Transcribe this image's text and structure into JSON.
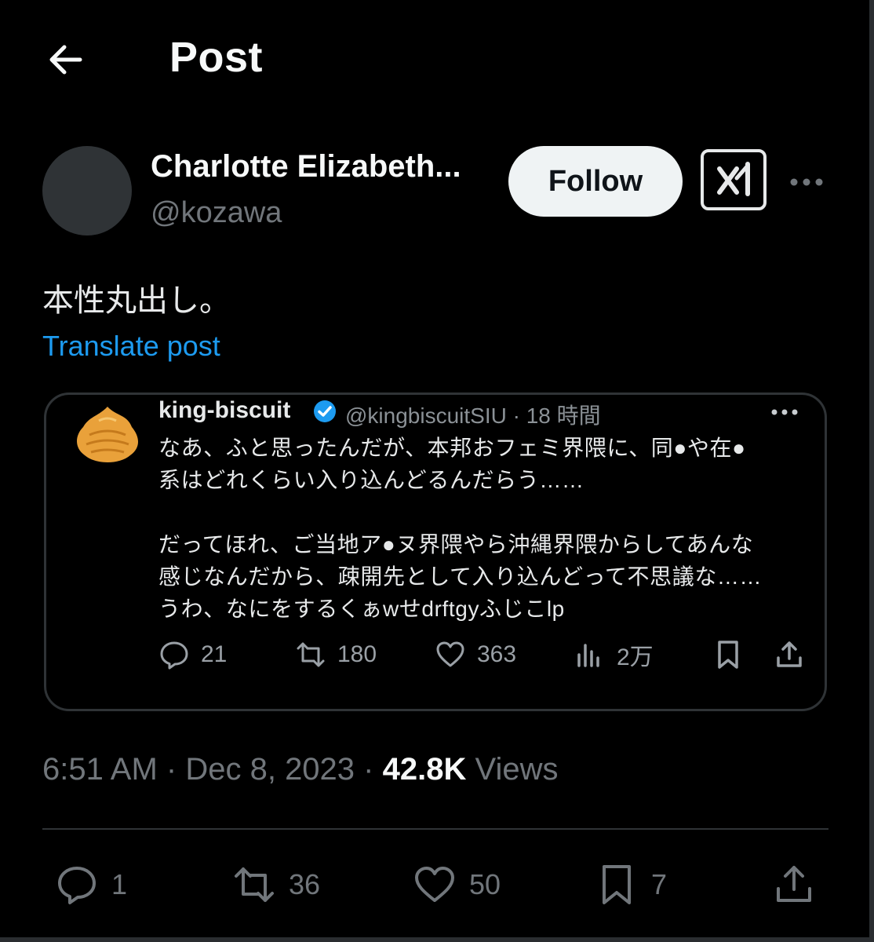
{
  "header": {
    "title": "Post"
  },
  "author": {
    "name": "Charlotte Elizabeth...",
    "handle": "@kozawa"
  },
  "follow_label": "Follow",
  "post": {
    "text": "本性丸出し。",
    "translate_label": "Translate post"
  },
  "quote": {
    "name": "king-biscuit",
    "handle_time": "@kingbiscuitSIU · 18 時間",
    "text": "なあ、ふと思ったんだが、本邦おフェミ界隈に、同●や在●\n系はどれくらい入り込んどるんだらう……\n\nだってほれ、ご当地ア●ヌ界隈やら沖縄界隈からしてあんな\n感じなんだから、疎開先として入り込んどって不思議な……\nうわ、なにをするくぁwせdrftgyふじこlp",
    "stats": {
      "replies": "21",
      "reposts": "180",
      "likes": "363",
      "views": "2万"
    }
  },
  "meta": {
    "time": "6:51 AM",
    "sep": "·",
    "date": "Dec 8, 2023",
    "views_count": "42.8K",
    "views_label": "Views"
  },
  "actions": {
    "replies": "1",
    "reposts": "36",
    "likes": "50",
    "bookmarks": "7"
  },
  "colors": {
    "background": "#000000",
    "accent": "#1d9bf0",
    "muted": "#71767b",
    "verified": "#1d9bf0"
  },
  "icons": [
    "back-arrow-icon",
    "grok-icon",
    "more-icon",
    "verified-icon",
    "reply-icon",
    "repost-icon",
    "like-icon",
    "views-icon",
    "bookmark-icon",
    "share-icon"
  ]
}
